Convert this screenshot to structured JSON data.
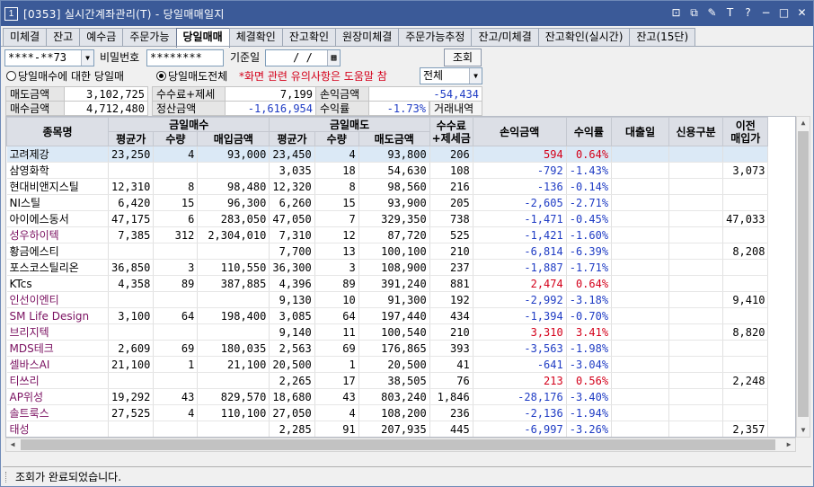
{
  "window": {
    "app_icon": "1",
    "title": "[0353] 실시간계좌관리(T) - 당일매매일지",
    "controls": [
      "⊡",
      "⧉",
      "✎",
      "T",
      "?",
      "−",
      "□",
      "✕"
    ]
  },
  "tabs": [
    {
      "label": "미체결",
      "active": false
    },
    {
      "label": "잔고",
      "active": false
    },
    {
      "label": "예수금",
      "active": false
    },
    {
      "label": "주문가능",
      "active": false
    },
    {
      "label": "당일매매",
      "active": true
    },
    {
      "label": "체결확인",
      "active": false
    },
    {
      "label": "잔고확인",
      "active": false
    },
    {
      "label": "원장미체결",
      "active": false
    },
    {
      "label": "주문가능추정",
      "active": false
    },
    {
      "label": "잔고/미체결",
      "active": false
    },
    {
      "label": "잔고확인(실시간)",
      "active": false
    },
    {
      "label": "잔고(15단)",
      "active": false
    }
  ],
  "controls": {
    "account_value": "****-**73",
    "password_label": "비밀번호",
    "password_value": "********",
    "base_date_label": "기준일",
    "base_date_value": "/  /",
    "query_button": "조회",
    "radio_buy": "당일매수에 대한 당일매",
    "radio_sell": "당일매도전체",
    "notice": "*화면 관련 유의사항은 도움말 참",
    "filter_select": "전체"
  },
  "summary": {
    "sell_amount_label": "매도금액",
    "sell_amount": "3,102,725",
    "fee_tax_label": "수수료+제세",
    "fee_tax": "7,199",
    "pnl_label": "손익금액",
    "pnl": "-54,434",
    "buy_amount_label": "매수금액",
    "buy_amount": "4,712,480",
    "settle_label": "정산금액",
    "settle": "-1,616,954",
    "return_label": "수익률",
    "return": "-1.73%",
    "history_button": "거래내역"
  },
  "table": {
    "headers": {
      "name": "종목명",
      "buy_group": "금일매수",
      "sell_group": "금일매도",
      "fee": "수수료\n+제세금",
      "pnl": "손익금액",
      "rate": "수익률",
      "loan_date": "대출일",
      "credit": "신용구분",
      "prev": "이전\n매입가",
      "avg": "평균가",
      "qty": "수량",
      "buy_amt": "매입금액",
      "sell_amt": "매도금액"
    },
    "rows": [
      {
        "name": "고려제강",
        "b_avg": "23,250",
        "b_qty": "4",
        "b_amt": "93,000",
        "s_avg": "23,450",
        "s_qty": "4",
        "s_amt": "93,800",
        "fee": "206",
        "pnl": "594",
        "rate": "0.64%",
        "loan": "",
        "credit": "",
        "prev": "",
        "color": "",
        "selected": true
      },
      {
        "name": "삼영화학",
        "b_avg": "",
        "b_qty": "",
        "b_amt": "",
        "s_avg": "3,035",
        "s_qty": "18",
        "s_amt": "54,630",
        "fee": "108",
        "pnl": "-792",
        "rate": "-1.43%",
        "loan": "",
        "credit": "",
        "prev": "3,073",
        "color": "",
        "selected": false
      },
      {
        "name": "현대비앤지스틸",
        "b_avg": "12,310",
        "b_qty": "8",
        "b_amt": "98,480",
        "s_avg": "12,320",
        "s_qty": "8",
        "s_amt": "98,560",
        "fee": "216",
        "pnl": "-136",
        "rate": "-0.14%",
        "loan": "",
        "credit": "",
        "prev": "",
        "color": "",
        "selected": false
      },
      {
        "name": "NI스틸",
        "b_avg": "6,420",
        "b_qty": "15",
        "b_amt": "96,300",
        "s_avg": "6,260",
        "s_qty": "15",
        "s_amt": "93,900",
        "fee": "205",
        "pnl": "-2,605",
        "rate": "-2.71%",
        "loan": "",
        "credit": "",
        "prev": "",
        "color": "",
        "selected": false
      },
      {
        "name": "아이에스동서",
        "b_avg": "47,175",
        "b_qty": "6",
        "b_amt": "283,050",
        "s_avg": "47,050",
        "s_qty": "7",
        "s_amt": "329,350",
        "fee": "738",
        "pnl": "-1,471",
        "rate": "-0.45%",
        "loan": "",
        "credit": "",
        "prev": "47,033",
        "color": "",
        "selected": false
      },
      {
        "name": "성우하이텍",
        "b_avg": "7,385",
        "b_qty": "312",
        "b_amt": "2,304,010",
        "s_avg": "7,310",
        "s_qty": "12",
        "s_amt": "87,720",
        "fee": "525",
        "pnl": "-1,421",
        "rate": "-1.60%",
        "loan": "",
        "credit": "",
        "prev": "",
        "color": "pur",
        "selected": false
      },
      {
        "name": "황금에스티",
        "b_avg": "",
        "b_qty": "",
        "b_amt": "",
        "s_avg": "7,700",
        "s_qty": "13",
        "s_amt": "100,100",
        "fee": "210",
        "pnl": "-6,814",
        "rate": "-6.39%",
        "loan": "",
        "credit": "",
        "prev": "8,208",
        "color": "",
        "selected": false
      },
      {
        "name": "포스코스틸리온",
        "b_avg": "36,850",
        "b_qty": "3",
        "b_amt": "110,550",
        "s_avg": "36,300",
        "s_qty": "3",
        "s_amt": "108,900",
        "fee": "237",
        "pnl": "-1,887",
        "rate": "-1.71%",
        "loan": "",
        "credit": "",
        "prev": "",
        "color": "",
        "selected": false
      },
      {
        "name": "KTcs",
        "b_avg": "4,358",
        "b_qty": "89",
        "b_amt": "387,885",
        "s_avg": "4,396",
        "s_qty": "89",
        "s_amt": "391,240",
        "fee": "881",
        "pnl": "2,474",
        "rate": "0.64%",
        "loan": "",
        "credit": "",
        "prev": "",
        "color": "",
        "selected": false
      },
      {
        "name": "인선이엔티",
        "b_avg": "",
        "b_qty": "",
        "b_amt": "",
        "s_avg": "9,130",
        "s_qty": "10",
        "s_amt": "91,300",
        "fee": "192",
        "pnl": "-2,992",
        "rate": "-3.18%",
        "loan": "",
        "credit": "",
        "prev": "9,410",
        "color": "pur",
        "selected": false
      },
      {
        "name": "SM Life Design",
        "b_avg": "3,100",
        "b_qty": "64",
        "b_amt": "198,400",
        "s_avg": "3,085",
        "s_qty": "64",
        "s_amt": "197,440",
        "fee": "434",
        "pnl": "-1,394",
        "rate": "-0.70%",
        "loan": "",
        "credit": "",
        "prev": "",
        "color": "pur",
        "selected": false
      },
      {
        "name": "브리지텍",
        "b_avg": "",
        "b_qty": "",
        "b_amt": "",
        "s_avg": "9,140",
        "s_qty": "11",
        "s_amt": "100,540",
        "fee": "210",
        "pnl": "3,310",
        "rate": "3.41%",
        "loan": "",
        "credit": "",
        "prev": "8,820",
        "color": "pur",
        "selected": false
      },
      {
        "name": "MDS테크",
        "b_avg": "2,609",
        "b_qty": "69",
        "b_amt": "180,035",
        "s_avg": "2,563",
        "s_qty": "69",
        "s_amt": "176,865",
        "fee": "393",
        "pnl": "-3,563",
        "rate": "-1.98%",
        "loan": "",
        "credit": "",
        "prev": "",
        "color": "pur",
        "selected": false
      },
      {
        "name": "셀바스AI",
        "b_avg": "21,100",
        "b_qty": "1",
        "b_amt": "21,100",
        "s_avg": "20,500",
        "s_qty": "1",
        "s_amt": "20,500",
        "fee": "41",
        "pnl": "-641",
        "rate": "-3.04%",
        "loan": "",
        "credit": "",
        "prev": "",
        "color": "pur",
        "selected": false
      },
      {
        "name": "티쓰리",
        "b_avg": "",
        "b_qty": "",
        "b_amt": "",
        "s_avg": "2,265",
        "s_qty": "17",
        "s_amt": "38,505",
        "fee": "76",
        "pnl": "213",
        "rate": "0.56%",
        "loan": "",
        "credit": "",
        "prev": "2,248",
        "color": "pur",
        "selected": false
      },
      {
        "name": "AP위성",
        "b_avg": "19,292",
        "b_qty": "43",
        "b_amt": "829,570",
        "s_avg": "18,680",
        "s_qty": "43",
        "s_amt": "803,240",
        "fee": "1,846",
        "pnl": "-28,176",
        "rate": "-3.40%",
        "loan": "",
        "credit": "",
        "prev": "",
        "color": "pur",
        "selected": false
      },
      {
        "name": "솔트룩스",
        "b_avg": "27,525",
        "b_qty": "4",
        "b_amt": "110,100",
        "s_avg": "27,050",
        "s_qty": "4",
        "s_amt": "108,200",
        "fee": "236",
        "pnl": "-2,136",
        "rate": "-1.94%",
        "loan": "",
        "credit": "",
        "prev": "",
        "color": "pur",
        "selected": false
      },
      {
        "name": "태성",
        "b_avg": "",
        "b_qty": "",
        "b_amt": "",
        "s_avg": "2,285",
        "s_qty": "91",
        "s_amt": "207,935",
        "fee": "445",
        "pnl": "-6,997",
        "rate": "-3.26%",
        "loan": "",
        "credit": "",
        "prev": "2,357",
        "color": "pur",
        "selected": false
      }
    ]
  },
  "status": {
    "message": "조회가 완료되었습니다."
  },
  "colors": {
    "titlebar": "#3b5a98",
    "negative": "#1f3cc4",
    "positive": "#d4001a",
    "kosdaq_name": "#7a1060",
    "selected_row": "#dbe9f6"
  }
}
